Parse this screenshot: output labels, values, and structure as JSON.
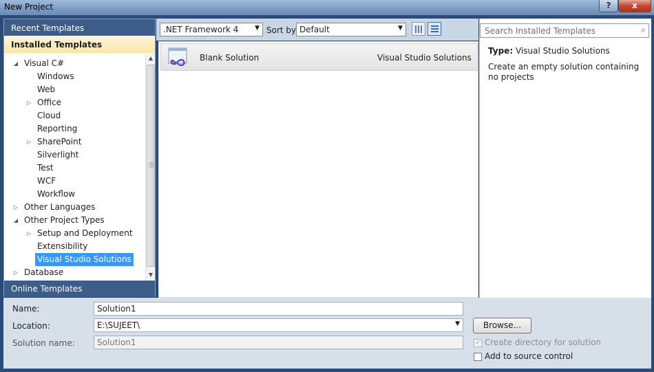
{
  "window": {
    "title": "New Project",
    "help_label": "?",
    "close_label": "x"
  },
  "left": {
    "recent_templates": "Recent Templates",
    "installed_templates": "Installed Templates",
    "online_templates": "Online Templates",
    "tree": [
      {
        "label": "Visual C#",
        "level": 0,
        "expander": "expanded"
      },
      {
        "label": "Windows",
        "level": 1,
        "expander": "none"
      },
      {
        "label": "Web",
        "level": 1,
        "expander": "none"
      },
      {
        "label": "Office",
        "level": 1,
        "expander": "collapsed"
      },
      {
        "label": "Cloud",
        "level": 1,
        "expander": "none"
      },
      {
        "label": "Reporting",
        "level": 1,
        "expander": "none"
      },
      {
        "label": "SharePoint",
        "level": 1,
        "expander": "collapsed"
      },
      {
        "label": "Silverlight",
        "level": 1,
        "expander": "none"
      },
      {
        "label": "Test",
        "level": 1,
        "expander": "none"
      },
      {
        "label": "WCF",
        "level": 1,
        "expander": "none"
      },
      {
        "label": "Workflow",
        "level": 1,
        "expander": "none"
      },
      {
        "label": "Other Languages",
        "level": 0,
        "expander": "collapsed"
      },
      {
        "label": "Other Project Types",
        "level": 0,
        "expander": "expanded"
      },
      {
        "label": "Setup and Deployment",
        "level": 1,
        "expander": "collapsed"
      },
      {
        "label": "Extensibility",
        "level": 1,
        "expander": "none"
      },
      {
        "label": "Visual Studio Solutions",
        "level": 1,
        "expander": "none",
        "selected": true
      },
      {
        "label": "Database",
        "level": 0,
        "expander": "collapsed"
      }
    ]
  },
  "toolbar": {
    "framework": ".NET Framework 4",
    "sort_by_label": "Sort by:",
    "sort_by_value": "Default"
  },
  "templates": [
    {
      "name": "Blank Solution",
      "category": "Visual Studio Solutions",
      "icon": "visual-studio-infinity-icon"
    }
  ],
  "details": {
    "search_placeholder": "Search Installed Templates",
    "type_label": "Type:",
    "type_value": "Visual Studio Solutions",
    "description": "Create an empty solution containing no projects"
  },
  "form": {
    "name_label": "Name:",
    "name_value": "Solution1",
    "location_label": "Location:",
    "location_value": "E:\\SUJEET\\",
    "solution_name_label": "Solution name:",
    "solution_name_value": "Solution1",
    "browse_label": "Browse...",
    "create_directory_label": "Create directory for solution",
    "create_directory_checked": true,
    "add_source_control_label": "Add to source control",
    "add_source_control_checked": false
  },
  "colors": {
    "header_blue": "#3d5c88",
    "selection_blue": "#3399ff",
    "installed_gold": "#fbe6a6",
    "window_bg": "#2b4a75"
  }
}
